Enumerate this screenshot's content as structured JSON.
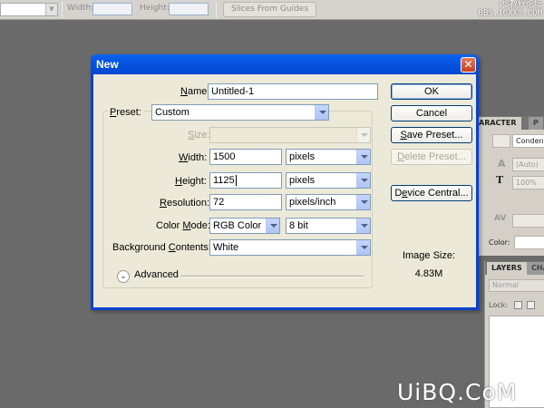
{
  "options_bar": {
    "width_label": "Width:",
    "height_label": "Height:",
    "slices_button": "Slices From Guides"
  },
  "watermark_top": {
    "line1": "PS教程论坛",
    "line2": "BBS.16XX8.COM"
  },
  "character_panel": {
    "tab_character": "ARACTER",
    "tab_paragraph": "P",
    "font": "Conden...",
    "leading": "(Auto)",
    "scale": "100%",
    "color_label": "Color:"
  },
  "layers_panel": {
    "tab_layers": "LAYERS",
    "tab_channels": "CHA",
    "blend_mode": "Normal",
    "lock_label": "Lock:"
  },
  "dialog": {
    "title": "New",
    "close_glyph": "✕",
    "name": {
      "label_u": "N",
      "label_rest": "ame:",
      "value": "Untitled-1"
    },
    "preset": {
      "label_u": "P",
      "label_rest": "reset:",
      "value": "Custom"
    },
    "size": {
      "label_u": "S",
      "label_rest": "ize:",
      "value": ""
    },
    "width": {
      "label_u": "W",
      "label_rest": "idth:",
      "value": "1500",
      "unit": "pixels"
    },
    "height": {
      "label_u": "H",
      "label_rest": "eight:",
      "value": "1125",
      "unit": "pixels"
    },
    "resolution": {
      "label_u": "R",
      "label_rest": "esolution:",
      "value": "72",
      "unit": "pixels/inch"
    },
    "color_mode": {
      "label_pre": "Color ",
      "label_u": "M",
      "label_rest": "ode:",
      "value": "RGB Color",
      "depth": "8 bit"
    },
    "background": {
      "label_pre": "Background ",
      "label_u": "C",
      "label_rest": "ontents:",
      "value": "White"
    },
    "advanced": {
      "glyph": "⌄",
      "label": "Advanced"
    },
    "buttons": {
      "ok": "OK",
      "cancel": "Cancel",
      "save_preset_u": "S",
      "save_preset_rest": "ave Preset...",
      "delete_preset_u": "D",
      "delete_preset_rest": "elete Preset...",
      "device_central_u": "e",
      "device_central_pre": "D",
      "device_central_rest": "vice Central..."
    },
    "image_size": {
      "caption": "Image Size:",
      "value": "4.83M"
    }
  },
  "watermark_bottom": "UiBQ.CoM",
  "colors": {
    "titlebar": "#0553e0",
    "dialog_bg": "#ece9d8",
    "workspace": "#6a6a6a",
    "close_button": "#c5401f"
  }
}
